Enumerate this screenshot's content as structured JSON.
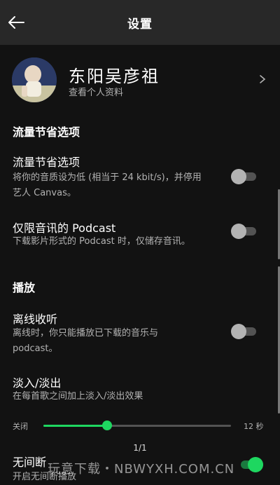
{
  "header": {
    "title": "设置",
    "back_icon": "arrow-left-icon"
  },
  "profile": {
    "name": "东阳吴彦祖",
    "subtitle": "查看个人资料",
    "chevron_icon": "chevron-right-icon"
  },
  "sections": {
    "data_saver": "流量节省选项",
    "playback": "播放"
  },
  "settings": {
    "data_saver": {
      "title": "流量节省选项",
      "desc_line1": "将你的音质设为低 (相当于 24 kbit/s)，并停用",
      "desc_line2": "艺人 Canvas。",
      "enabled": false
    },
    "audio_podcast": {
      "title": "仅限音讯的 Podcast",
      "desc": "下载影片形式的 Podcast 时，仅储存音讯。",
      "enabled": false
    },
    "offline": {
      "title": "离线收听",
      "desc_line1": "离线时，你只能播放已下载的音乐与",
      "desc_line2": "podcast。",
      "enabled": false
    },
    "crossfade": {
      "title": "淡入/淡出",
      "desc": "在每首歌之间加上淡入/淡出效果",
      "min_label": "关闭",
      "max_label": "12 秒",
      "value_fraction": 0.34
    },
    "gapless": {
      "title": "无间断",
      "desc": "开启无间断播放",
      "enabled": true
    }
  },
  "pager": {
    "text": "1/1"
  },
  "watermark": {
    "text": "玩意下载・NBWYXH.COM.CN"
  },
  "colors": {
    "accent": "#1ed760",
    "background": "#121212",
    "topbar": "#282828"
  }
}
